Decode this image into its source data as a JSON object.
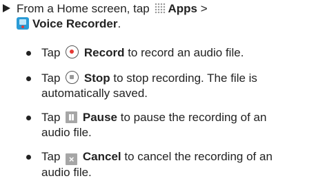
{
  "main_step": {
    "prefix": "From a Home screen, tap",
    "apps_label": "Apps",
    "separator": ">",
    "voice_recorder_label": "Voice Recorder",
    "suffix": "."
  },
  "bullets": [
    {
      "pre": "Tap",
      "label": "Record",
      "text_line1": "to record an audio file.",
      "text_line2": ""
    },
    {
      "pre": "Tap",
      "label": "Stop",
      "text_line1": "to stop recording. The file is",
      "text_line2": "automatically saved."
    },
    {
      "pre": "Tap",
      "label": "Pause",
      "text_line1": "to pause the recording of an",
      "text_line2": "audio file."
    },
    {
      "pre": "Tap",
      "label": "Cancel",
      "text_line1": "to cancel the recording of an",
      "text_line2": "audio file."
    }
  ],
  "icons": {
    "main_arrow": "triangle-right-icon",
    "apps": "apps-grid-icon",
    "voice_recorder": "voice-recorder-icon",
    "record": "record-icon",
    "stop": "stop-icon",
    "pause": "pause-icon",
    "cancel": "cancel-icon",
    "cancel_glyph": "×"
  },
  "colors": {
    "text": "#222222",
    "record_red": "#e53935",
    "app_blue": "#2a9bd6",
    "icon_gray": "#a6a6a6"
  }
}
